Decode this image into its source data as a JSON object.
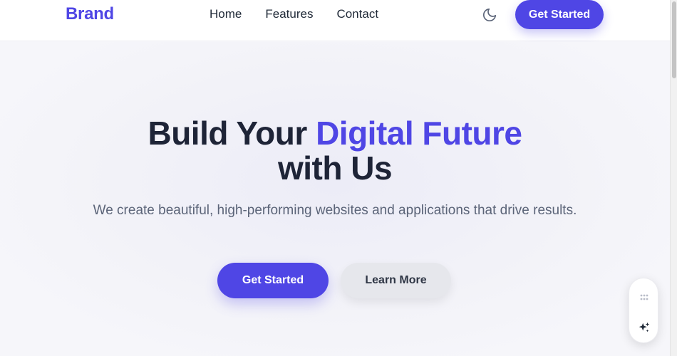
{
  "header": {
    "brand": "Brand",
    "nav": [
      {
        "label": "Home"
      },
      {
        "label": "Features"
      },
      {
        "label": "Contact"
      }
    ],
    "theme_toggle_icon": "moon-icon",
    "cta_label": "Get Started"
  },
  "hero": {
    "title_before": "Build Your ",
    "title_accent": "Digital Future",
    "title_after": " with Us",
    "subtitle": "We create beautiful, high-performing websites and applications that drive results.",
    "primary_label": "Get Started",
    "secondary_label": "Learn More"
  },
  "widget": {
    "grip_icon": "grip-dots-icon",
    "sparkle_icon": "sparkle-icon"
  },
  "colors": {
    "accent": "#4f46e5",
    "heading": "#1e2437",
    "body_text": "#5b6478",
    "secondary_button": "#e6e7ec"
  }
}
